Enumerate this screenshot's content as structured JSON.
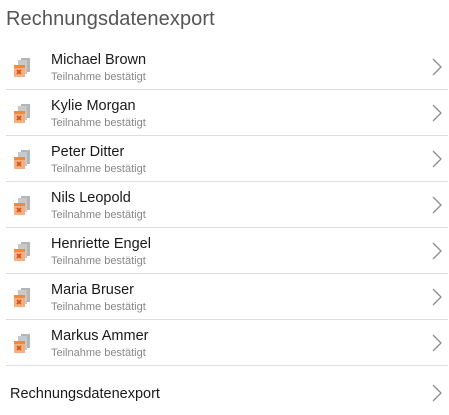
{
  "header": {
    "title": "Rechnungsdatenexport"
  },
  "icons": {
    "row_icon": "invoice-document-icon",
    "chevron": "chevron-right-icon",
    "accent_color": "#f08a3c",
    "doc_color": "#a9a9a9"
  },
  "list": {
    "items": [
      {
        "name": "Michael Brown",
        "status": "Teilnahme bestätigt"
      },
      {
        "name": "Kylie Morgan",
        "status": "Teilnahme bestätigt"
      },
      {
        "name": "Peter Ditter",
        "status": "Teilnahme bestätigt"
      },
      {
        "name": "Nils Leopold",
        "status": "Teilnahme bestätigt"
      },
      {
        "name": "Henriette Engel",
        "status": "Teilnahme bestätigt"
      },
      {
        "name": "Maria Bruser",
        "status": "Teilnahme bestätigt"
      },
      {
        "name": "Markus Ammer",
        "status": "Teilnahme bestätigt"
      }
    ]
  },
  "footer": {
    "label": "Rechnungsdatenexport"
  }
}
